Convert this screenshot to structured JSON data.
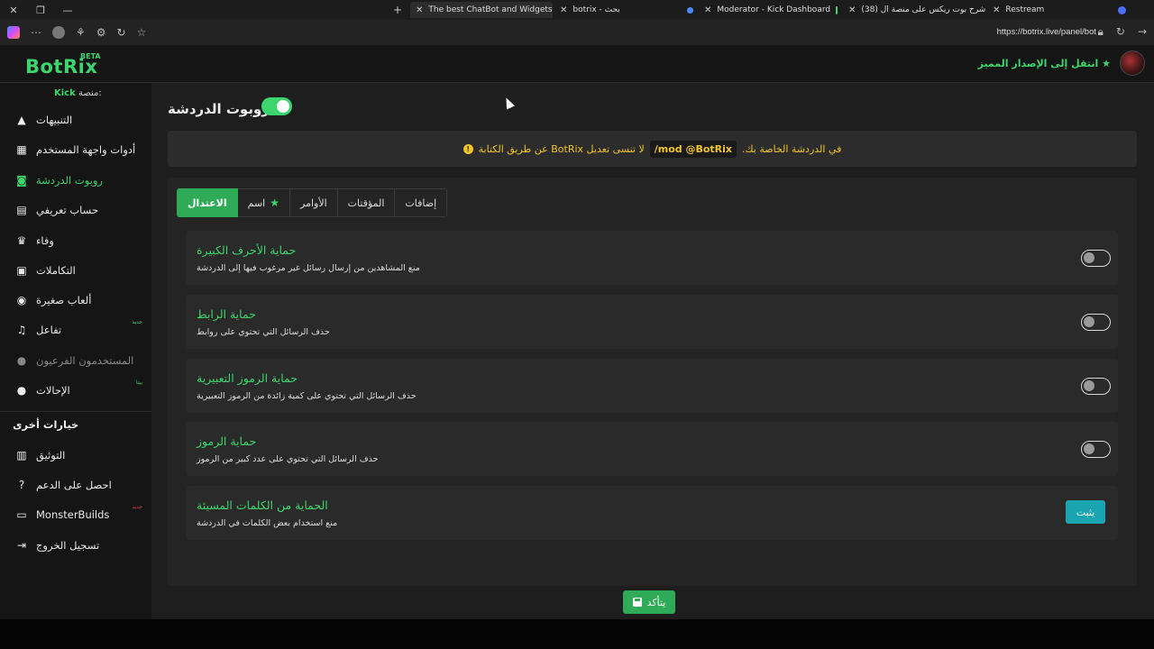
{
  "browser": {
    "window_controls": [
      "✕",
      "❐",
      "—"
    ],
    "tabs": [
      {
        "label": "The best ChatBot and Widgets fo",
        "favicon_color": "#ffffff"
      },
      {
        "label": "botrix - بحث",
        "favicon_color": "#4a8cff"
      },
      {
        "label": "Moderator - Kick Dashboard",
        "favicon_color": "#3dd56d"
      },
      {
        "label": "(38) شرح بوت ريكس على منصة ال",
        "favicon_color": "#ff2a2a"
      },
      {
        "label": "Restream",
        "favicon_color": "#4a6cff"
      }
    ],
    "url": "https://botrix.live/panel/bot"
  },
  "topbar": {
    "logo": "BotRix",
    "beta": "BETA",
    "premium_link": "انتقل إلى الإصدار المميز"
  },
  "sidebar": {
    "platform_label": "منصة:",
    "platform_value": "Kick",
    "items": [
      {
        "label": "التنبيهات",
        "icon": "warning-icon"
      },
      {
        "label": "أدوات واجهة المستخدم",
        "icon": "table-icon"
      },
      {
        "label": "روبوت الدردشة",
        "icon": "robot-icon"
      },
      {
        "label": "حساب تعريفي",
        "icon": "id-card-icon"
      },
      {
        "label": "وفاء",
        "icon": "trophy-icon"
      },
      {
        "label": "التكاملات",
        "icon": "window-icon"
      },
      {
        "label": "ألعاب صغيرة",
        "icon": "gamepad-icon"
      },
      {
        "label": "تفاعل",
        "icon": "music-icon",
        "badge": "جديد"
      },
      {
        "label": "المستخدمون الفرعيون",
        "icon": "users-icon"
      },
      {
        "label": "الإحالات",
        "icon": "user-group-icon",
        "badge": "بيتا"
      }
    ],
    "other_title": "خيارات أخرى",
    "other_items": [
      {
        "label": "التوثيق",
        "icon": "book-icon"
      },
      {
        "label": "احصل على الدعم",
        "icon": "question-icon"
      },
      {
        "label": "MonsterBuilds",
        "icon": "laptop-icon",
        "badge": "جديد"
      },
      {
        "label": "تسجيل الخروج",
        "icon": "logout-icon"
      }
    ]
  },
  "main": {
    "title": "روبوت الدردشة",
    "alert": {
      "part1": "في الدردشة الخاصة بك.",
      "code": "/mod @BotRix",
      "part2": "لا تنسى تعديل BotRix عن طريق الكتابة"
    },
    "tabs": [
      {
        "label": "الاعتدال",
        "active": true
      },
      {
        "label": "اسم",
        "star": true
      },
      {
        "label": "الأوامر"
      },
      {
        "label": "المؤقتات"
      },
      {
        "label": "إضافات"
      }
    ],
    "options": [
      {
        "title": "حماية الأحرف الكبيرة",
        "desc": "منع المشاهدين من إرسال رسائل غير مرغوب فيها إلى الدردشة",
        "enabled": false
      },
      {
        "title": "حماية الرابط",
        "desc": "حذف الرسائل التي تحتوي على روابط",
        "enabled": false
      },
      {
        "title": "حماية الرموز التعبيرية",
        "desc": "حذف الرسائل التي تحتوي على كمية زائدة من الرموز التعبيرية",
        "enabled": false
      },
      {
        "title": "حماية الرموز",
        "desc": "حذف الرسائل التي تحتوي على عدد كبير من الرموز",
        "enabled": false
      },
      {
        "title": "الحماية من الكلمات المسيئة",
        "desc": "منع استخدام بعض الكلمات في الدردشة",
        "button": "يثبت"
      }
    ],
    "save_label": "يتأكد"
  },
  "colors": {
    "accent": "#3dd56d",
    "warning": "#f2c52a",
    "button_blue": "#1aa3b0"
  }
}
